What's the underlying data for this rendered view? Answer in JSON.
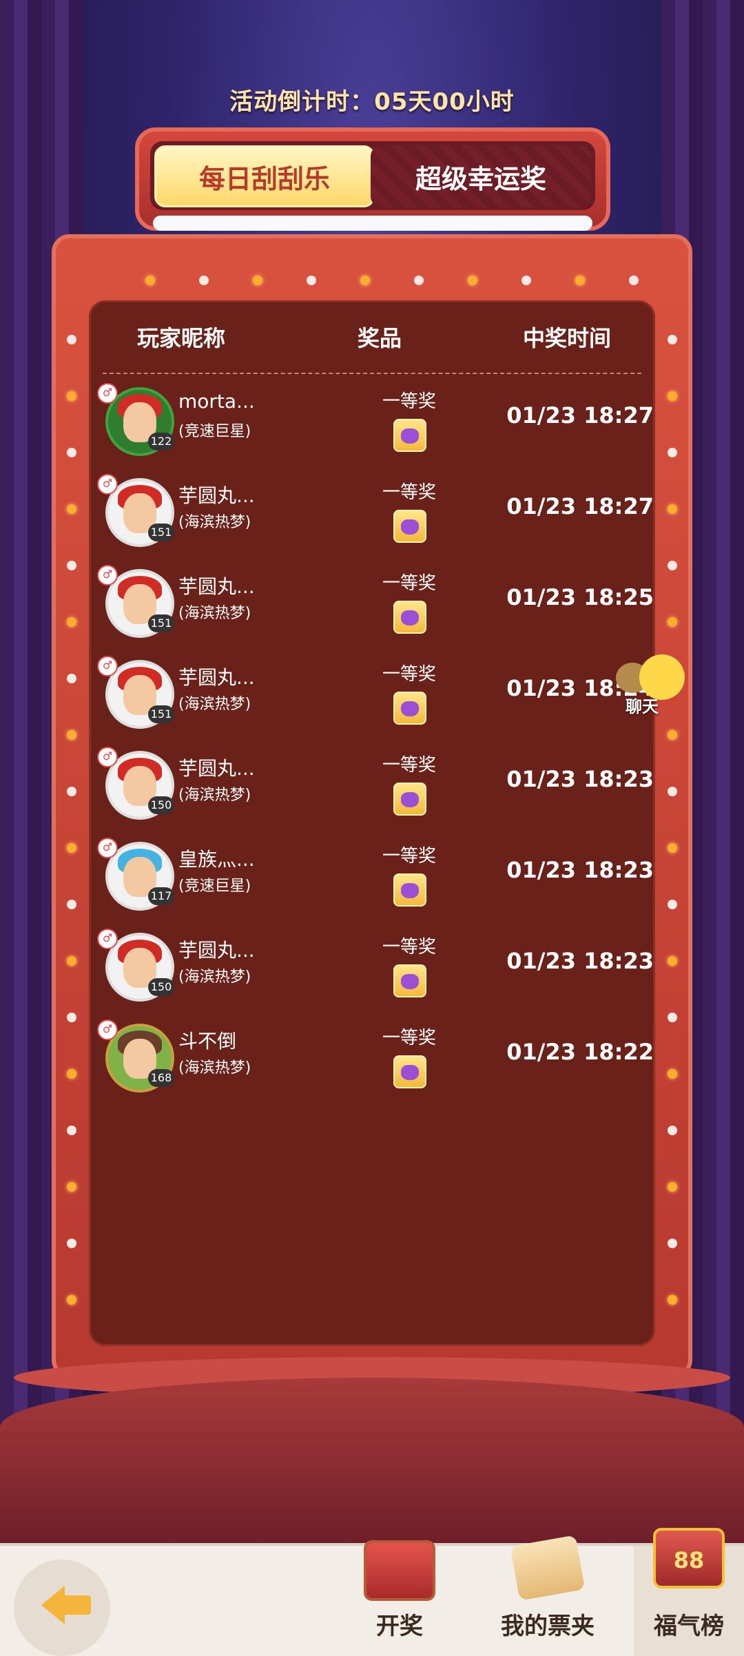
{
  "countdown": "活动倒计时：05天00小时",
  "tabs": [
    {
      "label": "每日刮刮乐",
      "active": true
    },
    {
      "label": "超级幸运奖",
      "active": false
    }
  ],
  "table": {
    "columns": [
      "玩家昵称",
      "奖品",
      "中奖时间"
    ],
    "rows": [
      {
        "name": "morta...",
        "title": "(竞速巨星)",
        "level": "122",
        "prize": "一等奖",
        "time": "01/23 18:27",
        "avatar": "green"
      },
      {
        "name": "芋圆丸...",
        "title": "(海滨热梦)",
        "level": "151",
        "prize": "一等奖",
        "time": "01/23 18:27",
        "avatar": "red"
      },
      {
        "name": "芋圆丸...",
        "title": "(海滨热梦)",
        "level": "151",
        "prize": "一等奖",
        "time": "01/23 18:25",
        "avatar": "red"
      },
      {
        "name": "芋圆丸...",
        "title": "(海滨热梦)",
        "level": "151",
        "prize": "一等奖",
        "time": "01/23 18:24",
        "avatar": "red"
      },
      {
        "name": "芋圆丸...",
        "title": "(海滨热梦)",
        "level": "150",
        "prize": "一等奖",
        "time": "01/23 18:23",
        "avatar": "red"
      },
      {
        "name": "皇族灬...",
        "title": "(竞速巨星)",
        "level": "117",
        "prize": "一等奖",
        "time": "01/23 18:23",
        "avatar": "blue"
      },
      {
        "name": "芋圆丸...",
        "title": "(海滨热梦)",
        "level": "150",
        "prize": "一等奖",
        "time": "01/23 18:23",
        "avatar": "red"
      },
      {
        "name": "斗不倒",
        "title": "(海滨热梦)",
        "level": "168",
        "prize": "一等奖",
        "time": "01/23 18:22",
        "avatar": "brown"
      }
    ]
  },
  "chat": {
    "label": "聊天"
  },
  "bottom_nav": {
    "open_label": "开奖",
    "tickets_label": "我的票夹",
    "rank_label": "福气榜",
    "rank_icon_text": "88"
  },
  "colors": {
    "board": "#b7392f",
    "panel": "#6a211a",
    "tab_active": "#ffd86a",
    "accent": "#ffe6a6"
  }
}
